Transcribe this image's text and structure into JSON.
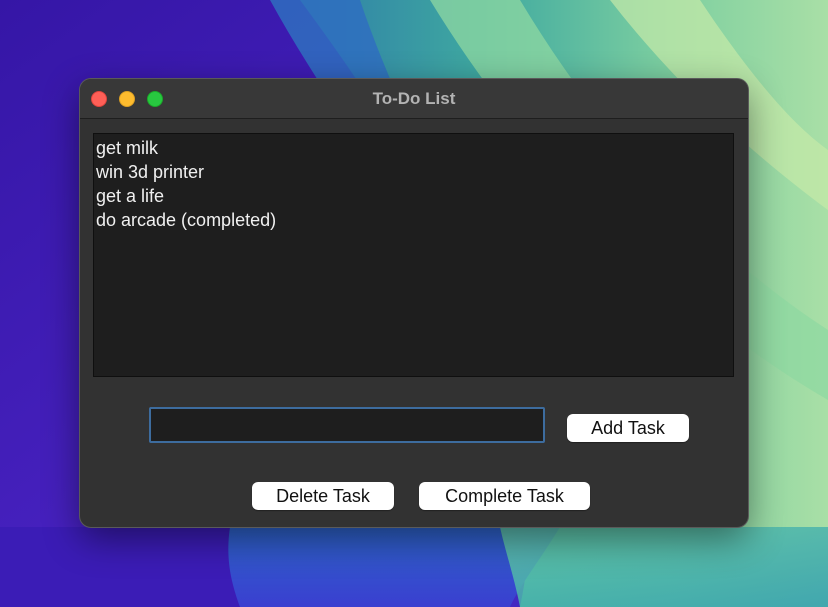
{
  "window": {
    "title": "To-Do List"
  },
  "tasks": [
    "get milk",
    "win 3d printer",
    "get a life",
    "do arcade (completed)"
  ],
  "entry": {
    "value": "",
    "placeholder": ""
  },
  "buttons": {
    "add_label": "Add Task",
    "delete_label": "Delete Task",
    "complete_label": "Complete Task"
  },
  "colors": {
    "close": "#fe5f57",
    "minimize": "#febc2e",
    "zoom": "#28c840",
    "entry_focus_border": "#3d6c9e",
    "window_bg": "#323232",
    "listbox_bg": "#1e1e1e"
  },
  "icons": {
    "close": "close-icon",
    "minimize": "minimize-icon",
    "zoom": "zoom-icon"
  }
}
